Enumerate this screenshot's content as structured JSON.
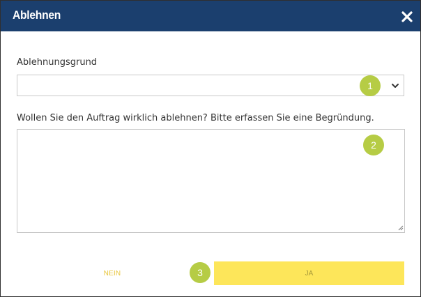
{
  "dialog": {
    "title": "Ablehnen",
    "close_icon": "close-icon"
  },
  "form": {
    "reason_label": "Ablehnungsgrund",
    "reason_value": "",
    "question_label": "Wollen Sie den Auftrag wirklich ablehnen? Bitte erfassen Sie eine Begründung.",
    "comment_value": ""
  },
  "badges": [
    "1",
    "2",
    "3"
  ],
  "actions": {
    "no_label": "NEIN",
    "yes_label": "JA"
  },
  "colors": {
    "header": "#1b3f6e",
    "badge": "#b6cc45",
    "yes_button": "#fde65a",
    "no_text": "#e8c53a"
  }
}
